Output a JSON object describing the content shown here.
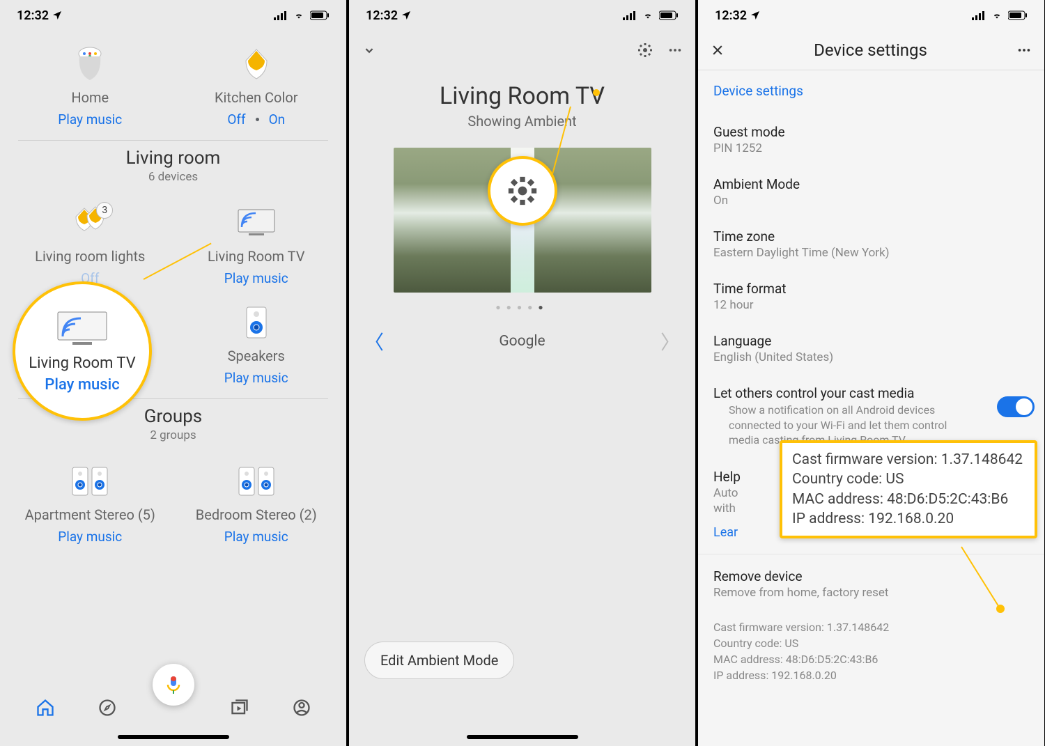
{
  "status": {
    "time": "12:32"
  },
  "screen1": {
    "tiles": [
      {
        "label": "Home",
        "action": "Play music"
      },
      {
        "label": "Kitchen Color",
        "off": "Off",
        "on": "On"
      }
    ],
    "living_room": {
      "title": "Living room",
      "sub": "6 devices",
      "items": [
        {
          "label": "Living room lights",
          "action": "Off",
          "badge": "3"
        },
        {
          "label": "Living Room TV",
          "action": "Play music"
        },
        {
          "label": "",
          "action": ""
        },
        {
          "label": "Speakers",
          "action": "Play music"
        }
      ]
    },
    "groups": {
      "title": "Groups",
      "sub": "2 groups",
      "items": [
        {
          "label": "Apartment Stereo (5)",
          "action": "Play music"
        },
        {
          "label": "Bedroom Stereo (2)",
          "action": "Play music"
        }
      ]
    },
    "callout": {
      "label": "Living Room TV",
      "action": "Play music"
    }
  },
  "screen2": {
    "title": "Living Room TV",
    "subtitle": "Showing Ambient",
    "carousel_label": "Google",
    "edit_button": "Edit Ambient Mode"
  },
  "screen3": {
    "title": "Device settings",
    "header_link": "Device settings",
    "items": {
      "guest_mode": {
        "k": "Guest mode",
        "v": "PIN 1252"
      },
      "ambient": {
        "k": "Ambient Mode",
        "v": "On"
      },
      "timezone": {
        "k": "Time zone",
        "v": "Eastern Daylight Time (New York)"
      },
      "timeformat": {
        "k": "Time format",
        "v": "12 hour"
      },
      "language": {
        "k": "Language",
        "v": "English (United States)"
      },
      "let_others": {
        "k": "Let others control your cast media",
        "desc": "Show a notification on all Android devices connected to your Wi-Fi and let them control media casting from Living Room TV"
      },
      "help": {
        "k": "Help",
        "desc": "Auto",
        "desc2": "with",
        "learn": "Lear"
      },
      "remove": {
        "k": "Remove device",
        "v": "Remove from home, factory reset"
      }
    },
    "info": {
      "fw": "Cast firmware version: 1.37.148642",
      "cc": "Country code: US",
      "mac": "MAC address: 48:D6:D5:2C:43:B6",
      "ip": "IP address: 192.168.0.20"
    }
  }
}
